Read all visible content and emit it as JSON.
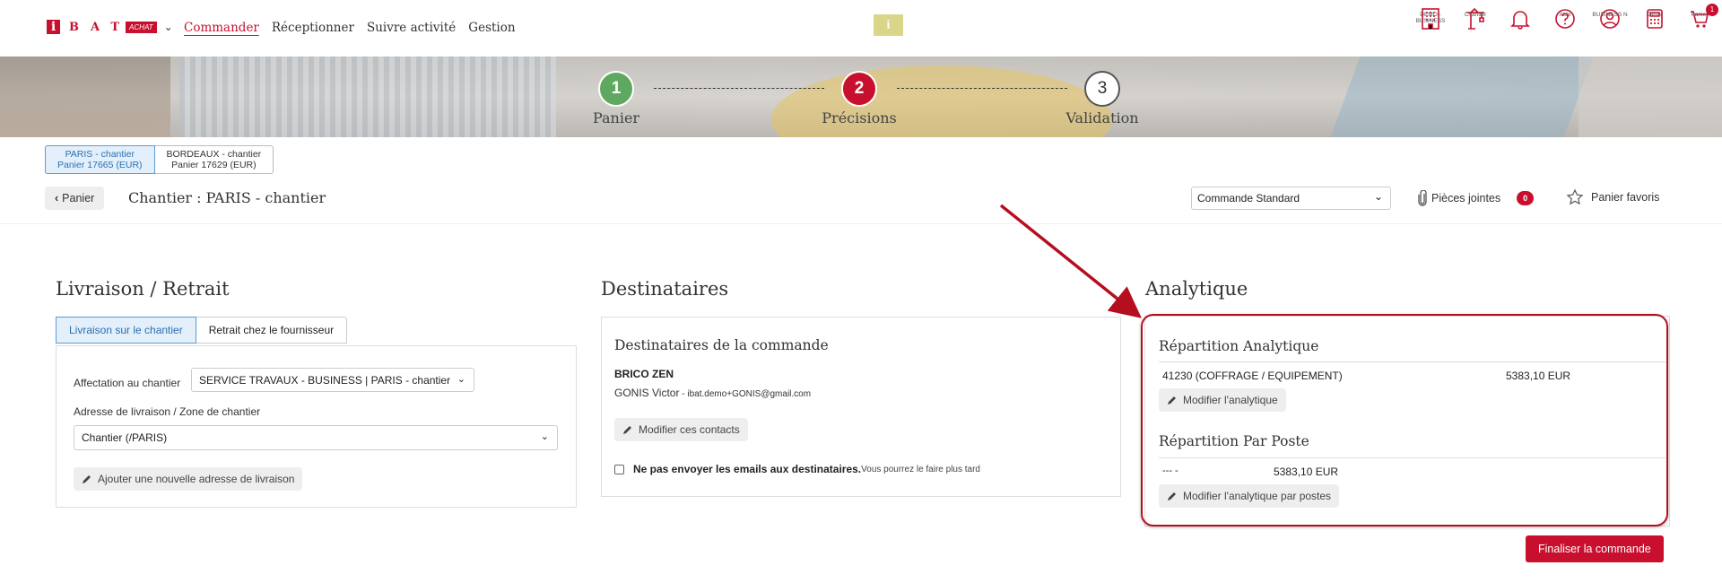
{
  "header": {
    "logo_i": "i",
    "logo_letters": "BAT",
    "logo_badge": "ACHAT",
    "nav": [
      "Commander",
      "Réceptionner",
      "Suivre activité",
      "Gestion"
    ],
    "center_logo": "i",
    "icons": [
      {
        "icon": "building-icon",
        "label": "DEMO - BUSINESS"
      },
      {
        "icon": "crane-icon",
        "label": "Chantier"
      },
      {
        "icon": "bell-icon",
        "label": ""
      },
      {
        "icon": "help-icon",
        "label": "Aide"
      },
      {
        "icon": "user-icon",
        "label": "BUSINESS N"
      },
      {
        "icon": "calculator-icon",
        "label": "Devis"
      },
      {
        "icon": "cart-icon",
        "label": "Panier",
        "badge": "1"
      }
    ]
  },
  "steps": [
    {
      "number": "1",
      "label": "Panier",
      "color": "#5fa85f"
    },
    {
      "number": "2",
      "label": "Précisions",
      "color": "#c8102e"
    },
    {
      "number": "3",
      "label": "Validation",
      "color": "#ffffff"
    }
  ],
  "carts": [
    {
      "line1": "PARIS - chantier",
      "line2": "Panier 17665 (EUR)"
    },
    {
      "line1": "BORDEAUX - chantier",
      "line2": "Panier 17629 (EUR)"
    }
  ],
  "context": {
    "back_label": "Panier",
    "title": "Chantier : PARIS - chantier",
    "order_type": "Commande Standard",
    "attachments_label": "Pièces jointes",
    "attachments_count": "0",
    "favorites_label": "Panier favoris"
  },
  "livraison": {
    "title": "Livraison / Retrait",
    "tabs": [
      "Livraison sur le chantier",
      "Retrait chez le fournisseur"
    ],
    "affectation_label": "Affectation au chantier",
    "affectation_value": "SERVICE TRAVAUX - BUSINESS | PARIS - chantier",
    "adresse_label": "Adresse de livraison / Zone de chantier",
    "adresse_value": "Chantier (/PARIS)",
    "add_address_label": "Ajouter une nouvelle adresse de livraison"
  },
  "destinataires": {
    "title": "Destinataires",
    "panel_title": "Destinataires de la commande",
    "company": "BRICO ZEN",
    "contact_name": "GONIS Victor",
    "contact_email": " - ibat.demo+GONIS@gmail.com",
    "modify_label": "Modifier ces contacts",
    "no_email_label": "Ne pas envoyer les emails aux destinataires.",
    "no_email_hint": "Vous pourrez le faire plus tard"
  },
  "analytique": {
    "title": "Analytique",
    "repartition_title": "Répartition Analytique",
    "line_code": "41230 (COFFRAGE / EQUIPEMENT)",
    "line_amount": "5383,10 EUR",
    "modify_label": "Modifier l'analytique",
    "poste_title": "Répartition Par Poste",
    "poste_code": "--- -",
    "poste_amount": "5383,10 EUR",
    "modify_poste_label": "Modifier l'analytique par postes"
  },
  "footer": {
    "finaliser_label": "Finaliser la commande"
  },
  "colors": {
    "brand": "#c8102e",
    "active_tab": "#e3f0fb",
    "highlight": "#b50f1f"
  }
}
